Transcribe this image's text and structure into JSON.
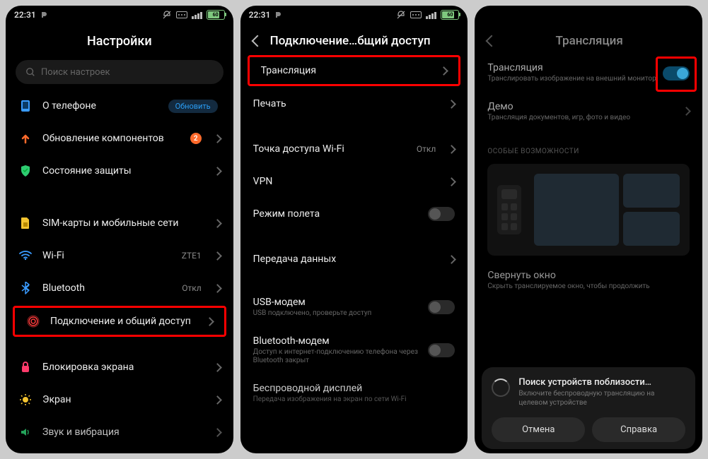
{
  "status": {
    "time": "22:31",
    "battery": "60"
  },
  "screen1": {
    "title": "Настройки",
    "search_placeholder": "Поиск настроек",
    "items": {
      "about": {
        "label": "О телефоне",
        "pill": "Обновить"
      },
      "updates": {
        "label": "Обновление компонентов",
        "badge": "2"
      },
      "security": {
        "label": "Состояние защиты"
      },
      "sim": {
        "label": "SIM-карты и мобильные сети"
      },
      "wifi": {
        "label": "Wi-Fi",
        "value": "ZTE1"
      },
      "bt": {
        "label": "Bluetooth",
        "value": "Откл"
      },
      "share": {
        "label": "Подключение и общий доступ"
      },
      "lock": {
        "label": "Блокировка экрана"
      },
      "display": {
        "label": "Экран"
      },
      "sound": {
        "label": "Звук и вибрация"
      }
    }
  },
  "screen2": {
    "title": "Подключение…бщий доступ",
    "items": {
      "cast": {
        "label": "Трансляция"
      },
      "print": {
        "label": "Печать"
      },
      "hotspot": {
        "label": "Точка доступа Wi-Fi",
        "value": "Откл"
      },
      "vpn": {
        "label": "VPN"
      },
      "airplane": {
        "label": "Режим полета"
      },
      "data": {
        "label": "Передача данных"
      },
      "usb": {
        "label": "USB-модем",
        "sub": "USB подключено, проверьте доступ"
      },
      "btm": {
        "label": "Bluetooth-модем",
        "sub": "Доступ к интернет-подключению телефона через Bluetooth закрыт"
      },
      "wd": {
        "label": "Беспроводной дисплей",
        "sub": "Передача изображения на экран по сети Wi-Fi"
      }
    }
  },
  "screen3": {
    "title": "Трансляция",
    "cast": {
      "label": "Трансляция",
      "sub": "Транслировать изображение на внешний монитор"
    },
    "demo": {
      "label": "Демо",
      "sub": "Трансляция документов, игр, фото и видео"
    },
    "section": "ОСОБЫЕ ВОЗМОЖНОСТИ",
    "minimize": {
      "label": "Свернуть окно",
      "sub": "Скрыть транслируемое окно, чтобы продолжить"
    },
    "modal": {
      "title": "Поиск устройств поблизости…",
      "sub": "Включите беспроводную трансляцию на целевом устройстве",
      "cancel": "Отмена",
      "help": "Справка"
    }
  }
}
